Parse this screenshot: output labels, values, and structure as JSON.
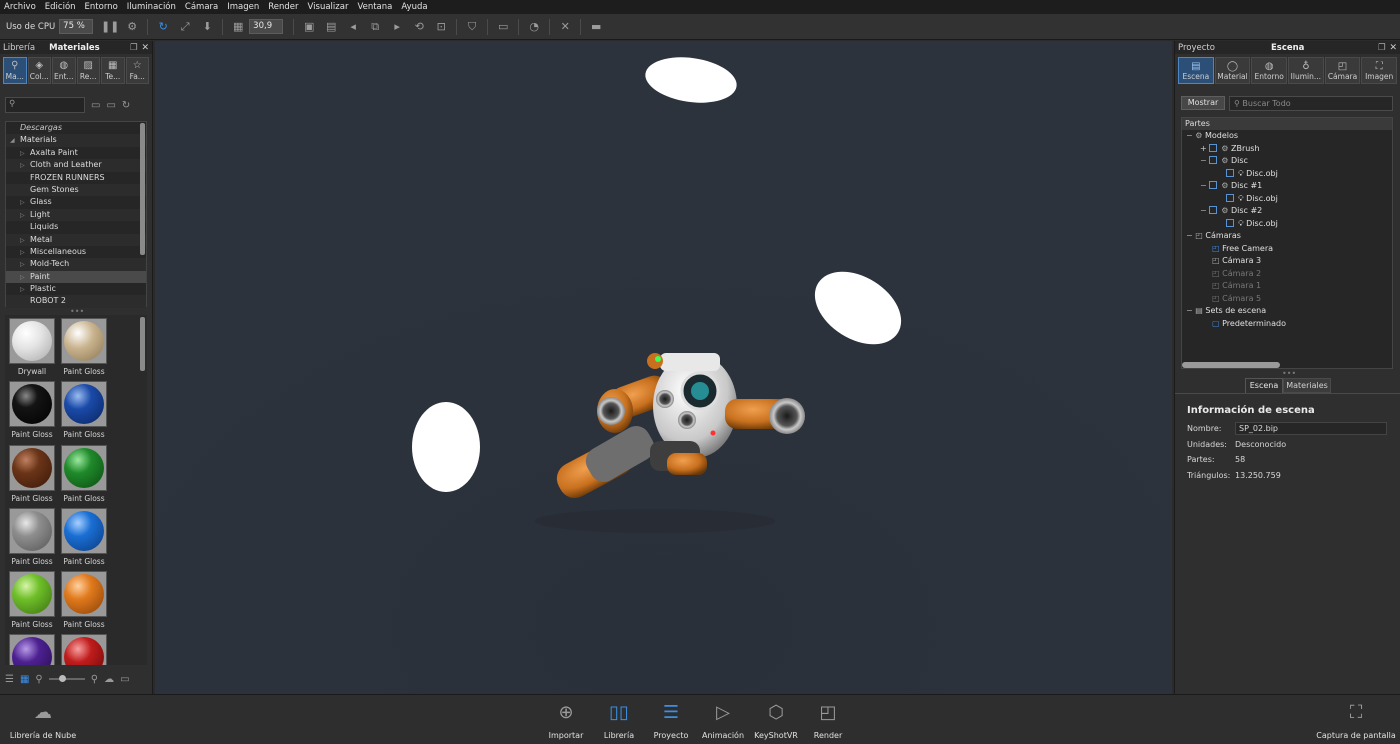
{
  "menu": [
    "Archivo",
    "Edición",
    "Entorno",
    "Iluminación",
    "Cámara",
    "Imagen",
    "Render",
    "Visualizar",
    "Ventana",
    "Ayuda"
  ],
  "toolbar": {
    "cpu_label": "Uso de CPU",
    "cpu_value": "75 %",
    "fov_value": "30,9"
  },
  "left_panel": {
    "title_inactive": "Librería",
    "title_active": "Materiales",
    "tabs": [
      "Ma...",
      "Col...",
      "Ent...",
      "Re...",
      "Te...",
      "Fa..."
    ],
    "tree": [
      {
        "label": "Descargas",
        "level": 0,
        "arrow": ""
      },
      {
        "label": "Materials",
        "level": 0,
        "arrow": "◢"
      },
      {
        "label": "Axalta Paint",
        "level": 1,
        "arrow": "▷"
      },
      {
        "label": "Cloth and Leather",
        "level": 1,
        "arrow": "▷"
      },
      {
        "label": "FROZEN RUNNERS",
        "level": 1,
        "arrow": ""
      },
      {
        "label": "Gem Stones",
        "level": 1,
        "arrow": ""
      },
      {
        "label": "Glass",
        "level": 1,
        "arrow": "▷"
      },
      {
        "label": "Light",
        "level": 1,
        "arrow": "▷"
      },
      {
        "label": "Liquids",
        "level": 1,
        "arrow": ""
      },
      {
        "label": "Metal",
        "level": 1,
        "arrow": "▷"
      },
      {
        "label": "Miscellaneous",
        "level": 1,
        "arrow": "▷"
      },
      {
        "label": "Mold-Tech",
        "level": 1,
        "arrow": "▷"
      },
      {
        "label": "Paint",
        "level": 1,
        "arrow": "▷"
      },
      {
        "label": "Plastic",
        "level": 1,
        "arrow": "▷"
      },
      {
        "label": "ROBOT 2",
        "level": 1,
        "arrow": ""
      }
    ],
    "swatches": [
      {
        "label": "Drywall",
        "color": "#e4e4e4"
      },
      {
        "label": "Paint Gloss ...",
        "color": "#c9b48f"
      },
      {
        "label": "Paint Gloss ...",
        "color": "#141414"
      },
      {
        "label": "Paint Gloss ...",
        "color": "#1a4aa8"
      },
      {
        "label": "Paint Gloss ...",
        "color": "#6a3418"
      },
      {
        "label": "Paint Gloss ...",
        "color": "#1f8a2a"
      },
      {
        "label": "Paint Gloss ...",
        "color": "#8e8e8e"
      },
      {
        "label": "Paint Gloss ...",
        "color": "#1a6fd4"
      },
      {
        "label": "Paint Gloss ...",
        "color": "#6fbf2a"
      },
      {
        "label": "Paint Gloss ...",
        "color": "#e07a1c"
      },
      {
        "label": "",
        "color": "#4d2191"
      },
      {
        "label": "",
        "color": "#c01c1c"
      }
    ]
  },
  "right_panel": {
    "title_inactive": "Proyecto",
    "title_active": "Escena",
    "tabs": [
      "Escena",
      "Material",
      "Entorno",
      "Ilumin...",
      "Cámara",
      "Imagen"
    ],
    "show_button": "Mostrar",
    "search_placeholder": "Buscar Todo",
    "tree_header": "Partes",
    "tree": [
      {
        "label": "Modelos",
        "indent": 0,
        "dim": false
      },
      {
        "label": "ZBrush",
        "indent": 1,
        "dim": false
      },
      {
        "label": "Disc",
        "indent": 1,
        "dim": false
      },
      {
        "label": "Disc.obj",
        "indent": 2,
        "dim": false
      },
      {
        "label": "Disc #1",
        "indent": 1,
        "dim": false
      },
      {
        "label": "Disc.obj",
        "indent": 2,
        "dim": false
      },
      {
        "label": "Disc #2",
        "indent": 1,
        "dim": false
      },
      {
        "label": "Disc.obj",
        "indent": 2,
        "dim": false
      },
      {
        "label": "Cámaras",
        "indent": 0,
        "dim": false
      },
      {
        "label": "Free Camera",
        "indent": 1,
        "dim": false
      },
      {
        "label": "Cámara 3",
        "indent": 1,
        "dim": false
      },
      {
        "label": "Cámara 2",
        "indent": 1,
        "dim": true
      },
      {
        "label": "Cámara 1",
        "indent": 1,
        "dim": true
      },
      {
        "label": "Cámara 5",
        "indent": 1,
        "dim": true
      },
      {
        "label": "Sets de escena",
        "indent": 0,
        "dim": false
      },
      {
        "label": "Predeterminado",
        "indent": 1,
        "dim": false
      }
    ],
    "lower_tabs": [
      "Escena",
      "Materiales"
    ],
    "info_title": "Información de escena",
    "info": {
      "name_label": "Nombre:",
      "name_value": "SP_02.bip",
      "units_label": "Unidades:",
      "units_value": "Desconocido",
      "parts_label": "Partes:",
      "parts_value": "58",
      "tris_label": "Triángulos:",
      "tris_value": "13.250.759"
    }
  },
  "bottom": {
    "cloud_library": "Librería de Nube",
    "import": "Importar",
    "library": "Librería",
    "project": "Proyecto",
    "animation": "Animación",
    "keyshotvr": "KeyShotVR",
    "render": "Render",
    "screenshot": "Captura de pantalla"
  }
}
